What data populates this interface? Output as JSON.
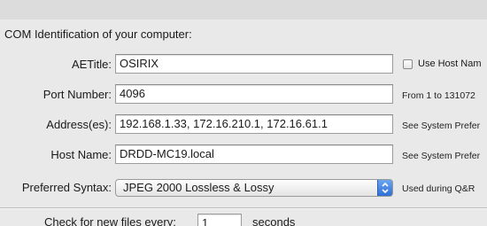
{
  "section": {
    "title": "COM Identification of your computer:"
  },
  "fields": {
    "aetitle": {
      "label": "AETitle:",
      "value": "OSIRIX"
    },
    "port": {
      "label": "Port Number:",
      "value": "4096",
      "hint": "From 1 to 131072"
    },
    "address": {
      "label": "Address(es):",
      "value": "192.168.1.33, 172.16.210.1, 172.16.61.1",
      "hint": "See System Prefer"
    },
    "host": {
      "label": "Host Name:",
      "value": "DRDD-MC19.local",
      "hint": "See System Prefer"
    },
    "syntax": {
      "label": "Preferred Syntax:",
      "value": "JPEG 2000 Lossless & Lossy",
      "hint": "Used during Q&R"
    }
  },
  "checkbox": {
    "label": "Use Host Nam",
    "checked": false
  },
  "check_files": {
    "prefix": "Check for new files every:",
    "value": "1",
    "suffix": "seconds"
  },
  "colors": {
    "popup_arrow_accent": "#2f6fd6",
    "panel_background": "#e9e9e9"
  },
  "icons": {
    "popup_arrows": "up-down-chevron-icon"
  }
}
